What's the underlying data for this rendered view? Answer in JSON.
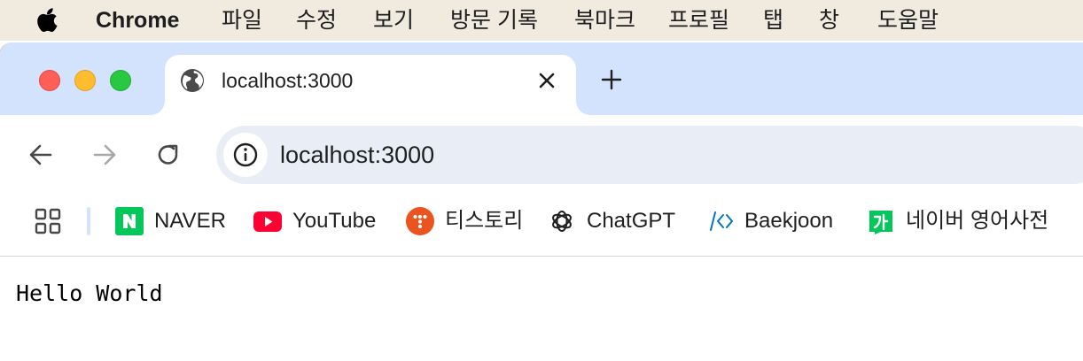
{
  "menubar": {
    "app_name": "Chrome",
    "items": [
      "파일",
      "수정",
      "보기",
      "방문 기록",
      "북마크",
      "프로필",
      "탭",
      "창",
      "도움말"
    ]
  },
  "tab": {
    "title": "localhost:3000",
    "icon": "globe-icon"
  },
  "toolbar": {
    "url": "localhost:3000"
  },
  "bookmarks": [
    {
      "label": "NAVER",
      "icon": "naver-icon",
      "color": "#03c75a"
    },
    {
      "label": "YouTube",
      "icon": "youtube-icon",
      "color": "#ff0033"
    },
    {
      "label": "티스토리",
      "icon": "tistory-icon",
      "color": "#eb531f"
    },
    {
      "label": "ChatGPT",
      "icon": "chatgpt-icon",
      "color": "#1f1f1f"
    },
    {
      "label": "Baekjoon",
      "icon": "baekjoon-icon",
      "color": "#0076c0"
    },
    {
      "label": "네이버 영어사전",
      "icon": "naver-dictionary-icon",
      "color": "#03c75a"
    }
  ],
  "content": {
    "text": "Hello World"
  },
  "colors": {
    "tabstrip": "#d3e3fd",
    "omnibox": "#e9eef6",
    "menubar": "#f1ebdf"
  }
}
